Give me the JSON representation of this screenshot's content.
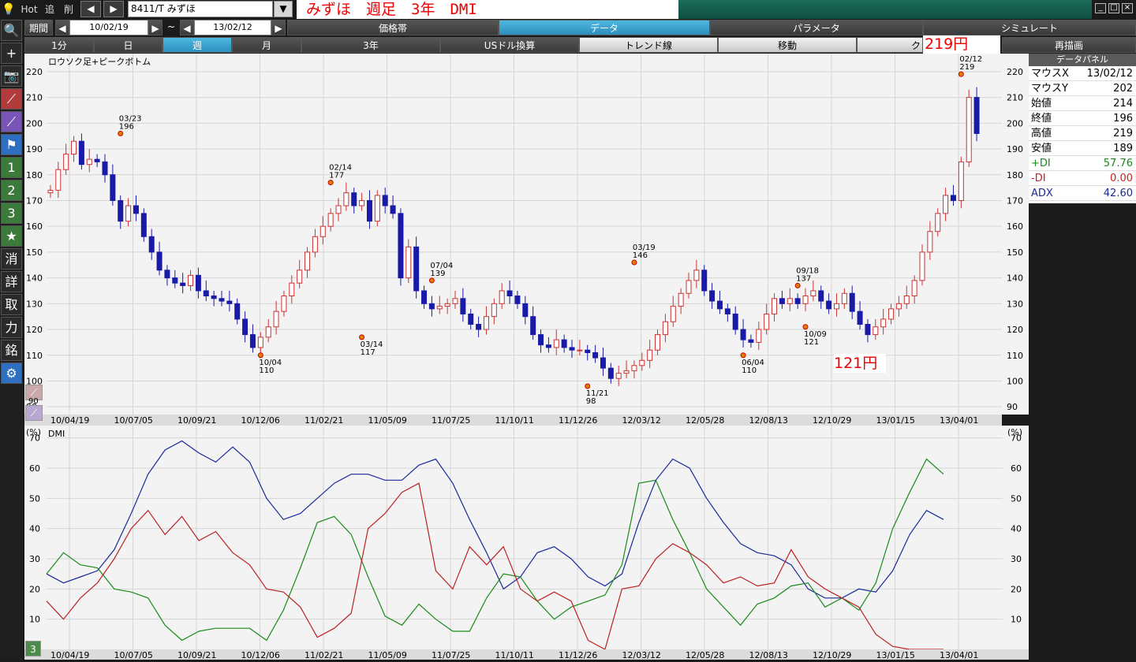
{
  "toolbar": {
    "hot": "Hot",
    "add": "追",
    "del": "削",
    "prev": "◀",
    "next": "▶",
    "symbol": "8411/T みずほ",
    "dropdown": "▼",
    "title": "みずほ　週足　3年　DMI"
  },
  "row2": {
    "period_label": "期間",
    "date_from": "10/02/19",
    "tilde": "~",
    "date_to": "13/02/12",
    "tabs": [
      "価格帯",
      "データ",
      "パラメータ",
      "シミュレート"
    ]
  },
  "row3": {
    "timeframes": [
      "1分",
      "日",
      "週",
      "月"
    ],
    "range": "3年",
    "buttons": [
      "USドル換算",
      "トレンド線",
      "移動",
      "ク"
    ],
    "price_tag": "219円",
    "redraw": "再描画"
  },
  "left_toolbar": [
    "🔍",
    "+",
    "📷",
    "⟋",
    "⟋",
    "⚑",
    "1",
    "2",
    "3",
    "★",
    "消",
    "詳",
    "取",
    "力",
    "銘",
    "⚙"
  ],
  "data_panel": {
    "header": "データパネル",
    "rows": [
      {
        "label": "マウスX",
        "value": "13/02/12",
        "color": "#000000"
      },
      {
        "label": "マウスY",
        "value": "202",
        "color": "#000000"
      },
      {
        "label": "始値",
        "value": "214",
        "color": "#000000"
      },
      {
        "label": "終値",
        "value": "196",
        "color": "#000000"
      },
      {
        "label": "高値",
        "value": "219",
        "color": "#000000"
      },
      {
        "label": "安値",
        "value": "189",
        "color": "#000000"
      },
      {
        "label": "+DI",
        "value": "57.76",
        "color": "#1a8a1a"
      },
      {
        "label": "-DI",
        "value": "0.00",
        "color": "#cc2222"
      },
      {
        "label": "ADX",
        "value": "42.60",
        "color": "#1a2a9a"
      }
    ]
  },
  "price_chart": {
    "title": "ロウソク足+ピークボトム",
    "y_ticks": [
      "220",
      "210",
      "200",
      "190",
      "180",
      "170",
      "160",
      "150",
      "140",
      "130",
      "120",
      "110",
      "100",
      "90"
    ],
    "x_ticks": [
      "10/04/19",
      "10/07/05",
      "10/09/21",
      "10/12/06",
      "11/02/21",
      "11/05/09",
      "11/07/25",
      "11/10/11",
      "11/12/26",
      "12/03/12",
      "12/05/28",
      "12/08/13",
      "12/10/29",
      "13/01/15",
      "13/04/01"
    ],
    "low_tag": "121円",
    "peaks": [
      {
        "date": "03/23",
        "price": "196"
      },
      {
        "date": "10/04",
        "price": "110"
      },
      {
        "date": "02/14",
        "price": "177"
      },
      {
        "date": "03/14",
        "price": "117"
      },
      {
        "date": "07/04",
        "price": "139"
      },
      {
        "date": "11/21",
        "price": "98"
      },
      {
        "date": "03/19",
        "price": "146"
      },
      {
        "date": "06/04",
        "price": "110"
      },
      {
        "date": "09/18",
        "price": "137"
      },
      {
        "date": "10/09",
        "price": "121"
      },
      {
        "date": "02/12",
        "price": "219"
      }
    ]
  },
  "dmi_chart": {
    "title": "DMI",
    "unit": "(%)",
    "y_ticks": [
      "70",
      "60",
      "50",
      "40",
      "30",
      "20",
      "10"
    ],
    "badge": "3",
    "small_value": "90"
  },
  "chart_data": [
    {
      "type": "candlestick",
      "title": "ロウソク足+ピークボトム",
      "ylim": [
        87,
        227
      ],
      "x_ticks": [
        "10/04/19",
        "10/07/05",
        "10/09/21",
        "10/12/06",
        "11/02/21",
        "11/05/09",
        "11/07/25",
        "11/10/11",
        "11/12/26",
        "12/03/12",
        "12/05/28",
        "12/08/13",
        "12/10/29",
        "13/01/15",
        "13/04/01"
      ],
      "closes": [
        174,
        182,
        188,
        193,
        184,
        186,
        185,
        180,
        170,
        162,
        168,
        165,
        156,
        150,
        143,
        140,
        138,
        137,
        141,
        135,
        133,
        132,
        131,
        130,
        124,
        118,
        113,
        117,
        121,
        127,
        133,
        138,
        143,
        150,
        156,
        160,
        165,
        168,
        173,
        168,
        170,
        162,
        172,
        168,
        165,
        140,
        152,
        135,
        130,
        128,
        129,
        130,
        132,
        126,
        122,
        120,
        125,
        130,
        135,
        133,
        130,
        125,
        118,
        114,
        113,
        116,
        113,
        112,
        112,
        111,
        109,
        105,
        101,
        103,
        104,
        106,
        108,
        112,
        118,
        123,
        129,
        134,
        139,
        143,
        135,
        131,
        128,
        126,
        120,
        116,
        115,
        120,
        126,
        132,
        130,
        132,
        130,
        133,
        135,
        131,
        128,
        130,
        134,
        127,
        122,
        118,
        121,
        124,
        128,
        130,
        133,
        139,
        150,
        158,
        165,
        172,
        170,
        185,
        210,
        196
      ],
      "peak_marks": [
        {
          "date": "03/23",
          "value": 196
        },
        {
          "date": "10/04",
          "value": 110
        },
        {
          "date": "02/14",
          "value": 177
        },
        {
          "date": "03/14",
          "value": 117
        },
        {
          "date": "07/04",
          "value": 139
        },
        {
          "date": "11/21",
          "value": 98
        },
        {
          "date": "03/19",
          "value": 146
        },
        {
          "date": "06/04",
          "value": 110
        },
        {
          "date": "09/18",
          "value": 137
        },
        {
          "date": "10/09",
          "value": 121
        },
        {
          "date": "02/12",
          "value": 219
        }
      ]
    },
    {
      "type": "line",
      "title": "DMI",
      "ylim": [
        0,
        72
      ],
      "x_ticks": [
        "10/04/19",
        "10/07/05",
        "10/09/21",
        "10/12/06",
        "11/02/21",
        "11/05/09",
        "11/07/25",
        "11/10/11",
        "11/12/26",
        "12/03/12",
        "12/05/28",
        "12/08/13",
        "12/10/29",
        "13/01/15",
        "13/04/01"
      ],
      "series": [
        {
          "name": "ADX",
          "color": "#1a2a9a",
          "values": [
            25,
            22,
            24,
            26,
            33,
            45,
            58,
            66,
            69,
            65,
            62,
            67,
            62,
            50,
            43,
            45,
            50,
            55,
            58,
            58,
            56,
            56,
            61,
            63,
            55,
            43,
            32,
            20,
            24,
            32,
            34,
            30,
            24,
            21,
            25,
            42,
            56,
            63,
            60,
            50,
            42,
            35,
            32,
            31,
            28,
            20,
            17,
            17,
            20,
            19,
            26,
            38,
            46,
            43
          ]
        },
        {
          "name": "+DI",
          "color": "#1a8a1a",
          "values": [
            25,
            32,
            28,
            27,
            20,
            19,
            17,
            8,
            3,
            6,
            7,
            7,
            7,
            3,
            13,
            27,
            42,
            44,
            38,
            24,
            11,
            8,
            15,
            10,
            6,
            6,
            17,
            25,
            24,
            16,
            10,
            14,
            16,
            18,
            28,
            55,
            56,
            43,
            32,
            20,
            14,
            8,
            15,
            17,
            21,
            22,
            14,
            17,
            13,
            22,
            40,
            52,
            63,
            58
          ]
        },
        {
          "name": "-DI",
          "color": "#bb2222",
          "values": [
            16,
            10,
            17,
            22,
            30,
            40,
            46,
            38,
            44,
            36,
            39,
            32,
            28,
            20,
            19,
            14,
            4,
            7,
            12,
            40,
            45,
            52,
            55,
            26,
            20,
            34,
            28,
            34,
            20,
            16,
            19,
            16,
            3,
            0,
            20,
            21,
            30,
            35,
            32,
            28,
            22,
            24,
            21,
            22,
            33,
            24,
            20,
            17,
            14,
            5,
            1,
            0,
            0,
            0
          ]
        }
      ]
    }
  ]
}
